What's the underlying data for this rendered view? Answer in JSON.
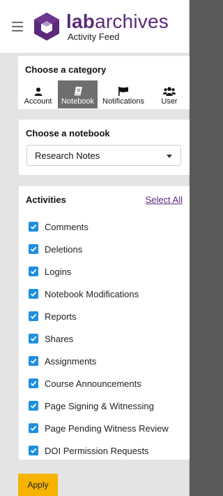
{
  "header": {
    "brand_bold": "lab",
    "brand_rest": "archives",
    "subtitle": "Activity Feed"
  },
  "category": {
    "title": "Choose a category",
    "items": [
      {
        "label": "Account",
        "icon": "user-icon",
        "active": false
      },
      {
        "label": "Notebook",
        "icon": "notebook-icon",
        "active": true
      },
      {
        "label": "Notifications",
        "icon": "flag-icon",
        "active": false
      },
      {
        "label": "User",
        "icon": "users-icon",
        "active": false
      }
    ]
  },
  "notebook": {
    "title": "Choose a notebook",
    "selected": "Research Notes"
  },
  "activities": {
    "title": "Activities",
    "select_all": "Select All",
    "items": [
      {
        "label": "Comments",
        "checked": true
      },
      {
        "label": "Deletions",
        "checked": true
      },
      {
        "label": "Logins",
        "checked": true
      },
      {
        "label": "Notebook Modifications",
        "checked": true
      },
      {
        "label": "Reports",
        "checked": true
      },
      {
        "label": "Shares",
        "checked": true
      },
      {
        "label": "Assignments",
        "checked": true
      },
      {
        "label": "Course Announcements",
        "checked": true
      },
      {
        "label": "Page Signing & Witnessing",
        "checked": true
      },
      {
        "label": "Page Pending Witness Review",
        "checked": true
      },
      {
        "label": "DOI Permission Requests",
        "checked": true
      }
    ]
  },
  "apply_label": "Apply",
  "colors": {
    "brand": "#5b2a7a",
    "checkbox": "#1e8fe0",
    "apply": "#f6b400",
    "active_tab": "#6e6e6e"
  }
}
